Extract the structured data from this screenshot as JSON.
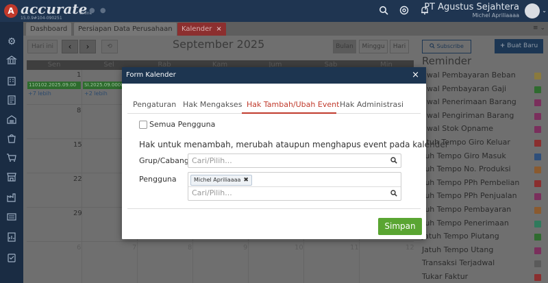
{
  "topbar": {
    "logo_letter": "A",
    "logo_name": "accurate",
    "logo_sub": "15.0.9#104-090251",
    "logo_online": "online",
    "company": "PT Agustus Sejahtera",
    "user": "Michel Apriliaaaa"
  },
  "tabs": [
    {
      "label": "Dashboard"
    },
    {
      "label": "Persiapan Data Perusahaan"
    },
    {
      "label": "Kalender",
      "close": "×"
    }
  ],
  "tabs_right": "≡ ⌄",
  "calendar": {
    "today_label": "Hari ini",
    "prev": "‹",
    "next": "›",
    "refresh": "⟲",
    "month_title": "September 2025",
    "views": [
      "Bulan",
      "Minggu",
      "Hari"
    ],
    "days": [
      "Sen",
      "Sel",
      "Rab",
      "Kam",
      "Jum",
      "Sab",
      "Min"
    ],
    "week_numbers": {
      "row1": [
        "1"
      ],
      "col1": [
        "8",
        "15",
        "22",
        "29"
      ],
      "last_row": [
        "6",
        "7",
        "8",
        "9",
        "10",
        "11",
        "12"
      ]
    },
    "events": [
      "110102.2025.09.00",
      "SI.2025.09.0000"
    ],
    "more": [
      "+7 lebih",
      "+2 lebih"
    ]
  },
  "reminder": {
    "subscribe_label": "Subscribe",
    "buat_label": "Buat Baru",
    "title": "Reminder",
    "items": [
      {
        "label": "dwal Pembayaran Beban",
        "color": "#8a7a3e"
      },
      {
        "label": "dwal Pembayaran Gaji",
        "color": "#2f6b2f"
      },
      {
        "label": "dwal Penerimaan Barang",
        "color": "#7a2f5c"
      },
      {
        "label": "dwal Pengiriman Barang",
        "color": "#7a2f5c"
      },
      {
        "label": "dwal Stok Opname",
        "color": "#7a2f5c"
      },
      {
        "label": "atuh Tempo Giro Keluar",
        "color": "#8a2f2f"
      },
      {
        "label": "tuh Tempo Giro Masuk",
        "color": "#2f4f7a"
      },
      {
        "label": "tuh Tempo No. Produksi",
        "color": "#8a5a2f"
      },
      {
        "label": "tuh Tempo PPh Pembelian",
        "color": "#8a2f2f"
      },
      {
        "label": "tuh Tempo PPh Penjualan",
        "color": "#7a2f5c"
      },
      {
        "label": "tuh Tempo Pembayaran",
        "color": "#8a5a2f"
      },
      {
        "label": "tuh Tempo Penerimaan",
        "color": "#2f7a5c"
      },
      {
        "label": "Jatuh Tempo Piutang",
        "color": "#2f6b2f"
      },
      {
        "label": "Jatuh Tempo Utang",
        "color": "#7a2f5c"
      },
      {
        "label": "Transaksi Terjadwal",
        "color": "#5a5a5a"
      },
      {
        "label": "Tukar Faktur",
        "color": "#8a2f2f"
      }
    ]
  },
  "modal": {
    "title": "Form Kalender",
    "close": "×",
    "tabs": [
      "Pengaturan",
      "Hak Mengakses",
      "Hak Tambah/Ubah Event",
      "Hak Administrasi"
    ],
    "active_tab": 2,
    "all_users_label": "Semua Pengguna",
    "description": "Hak untuk menambah, merubah ataupun menghapus event pada kalender",
    "branch_label": "Grup/Cabang",
    "branch_placeholder": "Cari/Pilih...",
    "user_label": "Pengguna",
    "user_chip": "Michel Apriliaaaa",
    "user_chip_remove": "✖",
    "user_placeholder": "Cari/Pilih...",
    "save_label": "Simpan"
  },
  "colors": {
    "navy": "#1d3550",
    "accent_red": "#c0392b",
    "save_green": "#5aa532"
  }
}
